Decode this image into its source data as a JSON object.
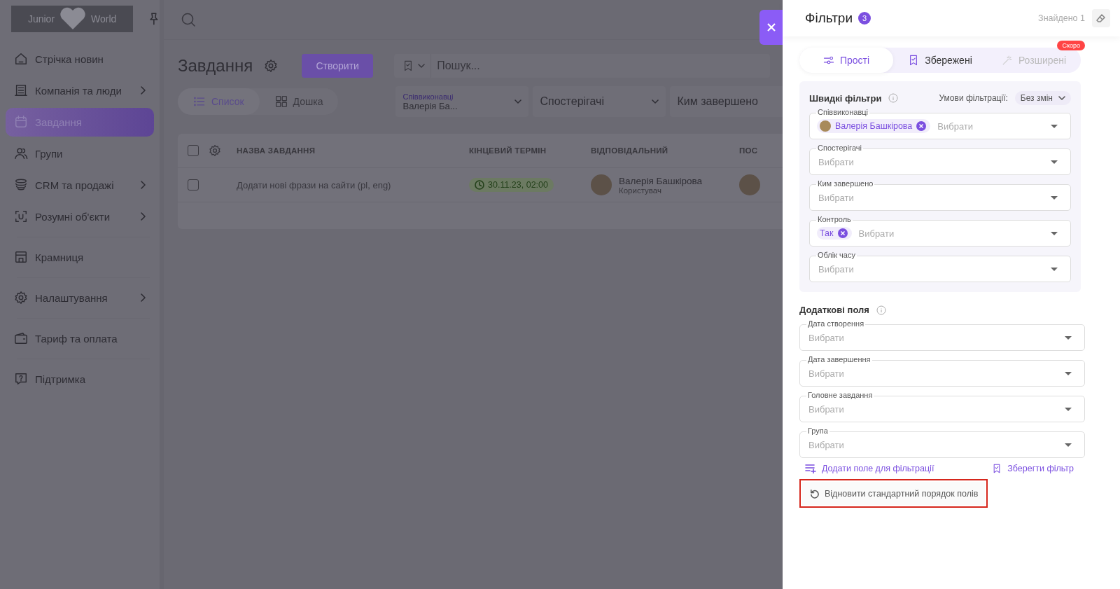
{
  "sidebar": {
    "logo": {
      "left": "Junior",
      "right": "World"
    },
    "items": [
      {
        "label": "Стрічка новин",
        "has_arrow": false,
        "selected": false
      },
      {
        "label": "Компанія та люди",
        "has_arrow": true,
        "selected": false
      },
      {
        "label": "Завдання",
        "has_arrow": false,
        "selected": true
      },
      {
        "label": "Групи",
        "has_arrow": false,
        "selected": false
      },
      {
        "label": "CRM та продажі",
        "has_arrow": true,
        "selected": false
      },
      {
        "label": "Розумні об'єкти",
        "has_arrow": true,
        "selected": false
      },
      {
        "label": "Крамниця",
        "has_arrow": false,
        "selected": false
      },
      {
        "label": "Налаштування",
        "has_arrow": true,
        "selected": false
      },
      {
        "label": "Тариф та оплата",
        "has_arrow": false,
        "selected": false
      },
      {
        "label": "Підтримка",
        "has_arrow": false,
        "selected": false
      }
    ]
  },
  "main": {
    "title": "Завдання",
    "create_button": "Створити",
    "search": {
      "placeholder": "Пошук..."
    },
    "views": [
      {
        "label": "Список",
        "selected": true
      },
      {
        "label": "Дошка",
        "selected": false
      }
    ],
    "filters": [
      {
        "label": "Співвиконавці",
        "value": "Валерія Ба..."
      },
      {
        "label": "Спостерігачі"
      },
      {
        "label": "Ким завершено"
      }
    ],
    "table": {
      "all_checked": false,
      "columns": [
        "НАЗВА ЗАВДАННЯ",
        "КІНЦЕВИЙ ТЕРМІН",
        "ВІДПОВІДАЛЬНИЙ",
        "ПОС"
      ],
      "rows": [
        {
          "checked": false,
          "name": "Додати нові фрази на сайти (pl, eng)",
          "deadline": "30.11.23, 02:00",
          "assignee": "Валерія Башкірова",
          "role": "Користувач"
        }
      ]
    }
  },
  "panel": {
    "title": "Фільтри",
    "count": "3",
    "found": "Знайдено 1",
    "tabs": [
      {
        "label": "Прості",
        "selected": true,
        "disabled": false
      },
      {
        "label": "Збережені",
        "selected": false,
        "disabled": false
      },
      {
        "label": "Розширені",
        "selected": false,
        "disabled": true,
        "badge": "Скоро"
      }
    ],
    "quick": {
      "title": "Швидкі фільтри",
      "conditions_label": "Умови фільтрації:",
      "conditions_value": "Без змін",
      "fields": [
        {
          "label": "Співвиконавці",
          "chips": [
            {
              "text": "Валерія Башкірова",
              "avatar": true
            }
          ],
          "placeholder": "Вибрати"
        },
        {
          "label": "Спостерігачі",
          "placeholder": "Вибрати"
        },
        {
          "label": "Ким завершено",
          "placeholder": "Вибрати"
        },
        {
          "label": "Контроль",
          "chips": [
            {
              "text": "Так",
              "avatar": false
            }
          ],
          "placeholder": "Вибрати"
        },
        {
          "label": "Облік часу",
          "placeholder": "Вибрати"
        }
      ]
    },
    "extra": {
      "title": "Додаткові поля",
      "fields": [
        {
          "label": "Дата створення",
          "placeholder": "Вибрати"
        },
        {
          "label": "Дата завершення",
          "placeholder": "Вибрати"
        },
        {
          "label": "Головне завдання",
          "placeholder": "Вибрати"
        },
        {
          "label": "Група",
          "placeholder": "Вибрати"
        }
      ]
    },
    "add_field": "Додати поле для фільтрації",
    "save_filter": "Зберегти фільтр",
    "reset": "Відновити стандартний порядок полів",
    "reset_highlighted": true
  }
}
